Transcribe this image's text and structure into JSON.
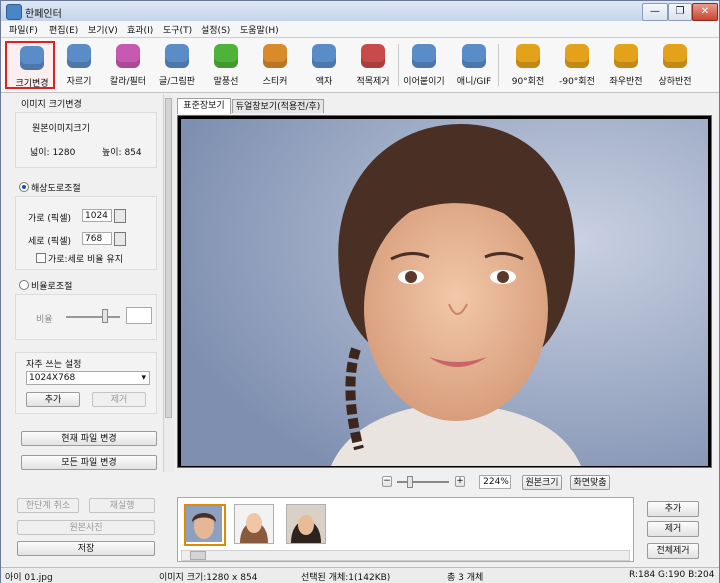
{
  "window": {
    "title": "한페인터",
    "min_glyph": "—",
    "max_glyph": "❐",
    "close_glyph": "✕"
  },
  "menu": [
    "파일(F)",
    "편집(E)",
    "보기(V)",
    "효과(I)",
    "도구(T)",
    "설정(S)",
    "도움말(H)"
  ],
  "toolbar": {
    "tools": [
      {
        "label": "크기변경",
        "icon": "resize-icon",
        "color": "#5a8cc7",
        "selected": true
      },
      {
        "label": "자르기",
        "icon": "crop-icon",
        "color": "#5a8cc7"
      },
      {
        "label": "칼라/필터",
        "icon": "color-filter-icon",
        "color": "#c75ab0"
      },
      {
        "label": "글/그림판",
        "icon": "text-draw-icon",
        "color": "#5a8cc7"
      },
      {
        "label": "말풍선",
        "icon": "speech-bubble-icon",
        "color": "#4fb33b"
      },
      {
        "label": "스티커",
        "icon": "sticker-icon",
        "color": "#d98a2b"
      },
      {
        "label": "액자",
        "icon": "frame-icon",
        "color": "#5a8cc7"
      },
      {
        "label": "적목제거",
        "icon": "redeye-icon",
        "color": "#c94a4a"
      },
      {
        "label": "이어붙이기",
        "icon": "merge-icon",
        "color": "#5a8cc7"
      },
      {
        "label": "애니/GIF",
        "icon": "gif-icon",
        "color": "#5a8cc7"
      },
      {
        "label": "90°회전",
        "icon": "rotate-cw-icon",
        "color": "#e3a21a"
      },
      {
        "label": "-90°회전",
        "icon": "rotate-ccw-icon",
        "color": "#e3a21a"
      },
      {
        "label": "좌우반전",
        "icon": "flip-horizontal-icon",
        "color": "#e3a21a"
      },
      {
        "label": "상하반전",
        "icon": "flip-vertical-icon",
        "color": "#e3a21a"
      }
    ]
  },
  "left_panel": {
    "section_title": "이미지 크기변경",
    "original_size_label": "원본이미지크기",
    "width_text": "넓이: 1280",
    "height_text": "높이:  854",
    "resolution_radio": "해상도로조절",
    "width_px_label": "가로 (픽셀)",
    "width_px_value": "1024",
    "height_px_label": "세로 (픽셀)",
    "height_px_value": "768",
    "keep_ratio_label": "가로:세로 비율 유지",
    "ratio_radio": "비율로조절",
    "ratio_label": "비율",
    "ratio_slider_level": 0.72,
    "favorites_label": "자주 쓰는 설정",
    "favorites_selected": "1024X768",
    "add_button": "추가",
    "remove_button": "제거",
    "change_current_button": "현재 파일 변경",
    "change_all_button": "모든 파일 변경",
    "undo_button": "한단계 취소",
    "redo_button": "재실행",
    "original_button": "원본사진",
    "save_button": "저장"
  },
  "tabs": [
    "표준장보기",
    "듀얼창보기(적용전/후)"
  ],
  "zoom": {
    "value": "224%",
    "original_size_button": "원본크기",
    "fit_button": "화면맞춤",
    "slider_level": 0.25,
    "minus": "−",
    "plus": "+"
  },
  "thumb_buttons": {
    "add": "추가",
    "remove": "제거",
    "remove_all": "전체제거"
  },
  "status": {
    "filename": "아이 01.jpg",
    "image_size": "이미지 크기:1280 x 854",
    "selected": "선택된 개체:1(142KB)",
    "total": "총 3 개체",
    "rgb": "R:184 G:190 B:204"
  },
  "colors": {
    "selected_tool_border": "#dd2222",
    "window_border": "#6b7a99",
    "accent": "#1e4fa8"
  }
}
